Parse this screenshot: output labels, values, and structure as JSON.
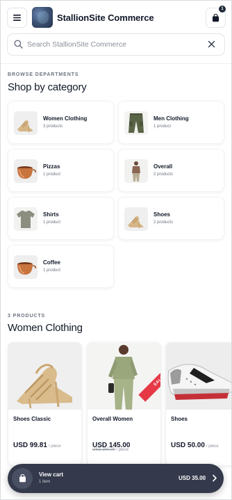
{
  "header": {
    "brand": "StallionSite Commerce",
    "cart_count": "1"
  },
  "search": {
    "placeholder": "Search StallionSite Commerce",
    "value": ""
  },
  "categories_section": {
    "eyebrow": "BROWSE DEPARTMENTS",
    "title": "Shop by category",
    "items": [
      {
        "name": "Women Clothing",
        "count": "3 products",
        "icon": "sandal-heels-image"
      },
      {
        "name": "Men Clothing",
        "count": "1 product",
        "icon": "cargo-pants-image"
      },
      {
        "name": "Pizzas",
        "count": "1 product",
        "icon": "copper-pot-image"
      },
      {
        "name": "Overall",
        "count": "2 products",
        "icon": "model-outfit-image"
      },
      {
        "name": "Shirts",
        "count": "1 product",
        "icon": "tshirt-image"
      },
      {
        "name": "Shoes",
        "count": "2 products",
        "icon": "sandal-heels-image"
      },
      {
        "name": "Coffee",
        "count": "1 product",
        "icon": "copper-pot-image"
      }
    ]
  },
  "products_section": {
    "eyebrow": "3 PRODUCTS",
    "title": "Women Clothing",
    "items": [
      {
        "name": "Shoes Classic",
        "price": "USD 99.81",
        "unit": "/ piece",
        "old_price": "",
        "badge": ""
      },
      {
        "name": "Overall Women",
        "price": "USD 145.00",
        "unit": "/ piece",
        "old_price": "USD 200.00",
        "badge": "SALE"
      },
      {
        "name": "Shoes",
        "price": "USD 50.00",
        "unit": "/ piece",
        "old_price": "",
        "badge": ""
      }
    ]
  },
  "cart_bar": {
    "title": "View cart",
    "subtitle": "1 item",
    "total": "USD 35.00"
  },
  "colors": {
    "accent_dark": "#343a4b",
    "sale_red": "#e53946",
    "text_primary": "#111827",
    "text_muted": "#6b7280"
  }
}
